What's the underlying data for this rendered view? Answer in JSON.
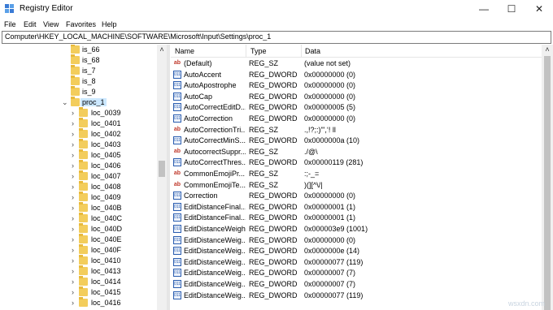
{
  "window": {
    "title": "Registry Editor"
  },
  "menu": [
    "File",
    "Edit",
    "View",
    "Favorites",
    "Help"
  ],
  "address": "Computer\\HKEY_LOCAL_MACHINE\\SOFTWARE\\Microsoft\\Input\\Settings\\proc_1",
  "tree": {
    "items": [
      "is_66",
      "is_68",
      "is_7",
      "is_8",
      "is_9",
      "proc_1",
      "loc_0039",
      "loc_0401",
      "loc_0402",
      "loc_0403",
      "loc_0405",
      "loc_0406",
      "loc_0407",
      "loc_0408",
      "loc_0409",
      "loc_040B",
      "loc_040C",
      "loc_040D",
      "loc_040E",
      "loc_040F",
      "loc_0410",
      "loc_0413",
      "loc_0414",
      "loc_0415",
      "loc_0416"
    ],
    "selected": "proc_1"
  },
  "columns": {
    "name": "Name",
    "type": "Type",
    "data": "Data"
  },
  "values": [
    {
      "icon": "string-value-icon",
      "name": "(Default)",
      "type": "REG_SZ",
      "data": "(value not set)"
    },
    {
      "icon": "dword-value-icon",
      "name": "AutoAccent",
      "type": "REG_DWORD",
      "data": "0x00000000 (0)"
    },
    {
      "icon": "dword-value-icon",
      "name": "AutoApostrophe",
      "type": "REG_DWORD",
      "data": "0x00000000 (0)"
    },
    {
      "icon": "dword-value-icon",
      "name": "AutoCap",
      "type": "REG_DWORD",
      "data": "0x00000000 (0)"
    },
    {
      "icon": "dword-value-icon",
      "name": "AutoCorrectEditD...",
      "type": "REG_DWORD",
      "data": "0x00000005 (5)"
    },
    {
      "icon": "dword-value-icon",
      "name": "AutoCorrection",
      "type": "REG_DWORD",
      "data": "0x00000000 (0)"
    },
    {
      "icon": "string-value-icon",
      "name": "AutoCorrectionTri...",
      "type": "REG_SZ",
      "data": ".,!?;:)\"',‘! ll"
    },
    {
      "icon": "dword-value-icon",
      "name": "AutoCorrectMinS...",
      "type": "REG_DWORD",
      "data": "0x0000000a (10)"
    },
    {
      "icon": "string-value-icon",
      "name": "AutocorrectSuppr...",
      "type": "REG_SZ",
      "data": "./@\\"
    },
    {
      "icon": "dword-value-icon",
      "name": "AutoCorrectThres...",
      "type": "REG_DWORD",
      "data": "0x00000119 (281)"
    },
    {
      "icon": "string-value-icon",
      "name": "CommonEmojiPr...",
      "type": "REG_SZ",
      "data": ":;-_="
    },
    {
      "icon": "string-value-icon",
      "name": "CommonEmojiTe...",
      "type": "REG_SZ",
      "data": ")(][^\\/|"
    },
    {
      "icon": "dword-value-icon",
      "name": "Correction",
      "type": "REG_DWORD",
      "data": "0x00000000 (0)"
    },
    {
      "icon": "dword-value-icon",
      "name": "EditDistanceFinal...",
      "type": "REG_DWORD",
      "data": "0x00000001 (1)"
    },
    {
      "icon": "dword-value-icon",
      "name": "EditDistanceFinal...",
      "type": "REG_DWORD",
      "data": "0x00000001 (1)"
    },
    {
      "icon": "dword-value-icon",
      "name": "EditDistanceWeight",
      "type": "REG_DWORD",
      "data": "0x000003e9 (1001)"
    },
    {
      "icon": "dword-value-icon",
      "name": "EditDistanceWeig...",
      "type": "REG_DWORD",
      "data": "0x00000000 (0)"
    },
    {
      "icon": "dword-value-icon",
      "name": "EditDistanceWeig...",
      "type": "REG_DWORD",
      "data": "0x0000000e (14)"
    },
    {
      "icon": "dword-value-icon",
      "name": "EditDistanceWeig...",
      "type": "REG_DWORD",
      "data": "0x00000077 (119)"
    },
    {
      "icon": "dword-value-icon",
      "name": "EditDistanceWeig...",
      "type": "REG_DWORD",
      "data": "0x00000007 (7)"
    },
    {
      "icon": "dword-value-icon",
      "name": "EditDistanceWeig...",
      "type": "REG_DWORD",
      "data": "0x00000007 (7)"
    },
    {
      "icon": "dword-value-icon",
      "name": "EditDistanceWeig...",
      "type": "REG_DWORD",
      "data": "0x00000077 (119)"
    }
  ],
  "watermark": "wsxdn.com"
}
